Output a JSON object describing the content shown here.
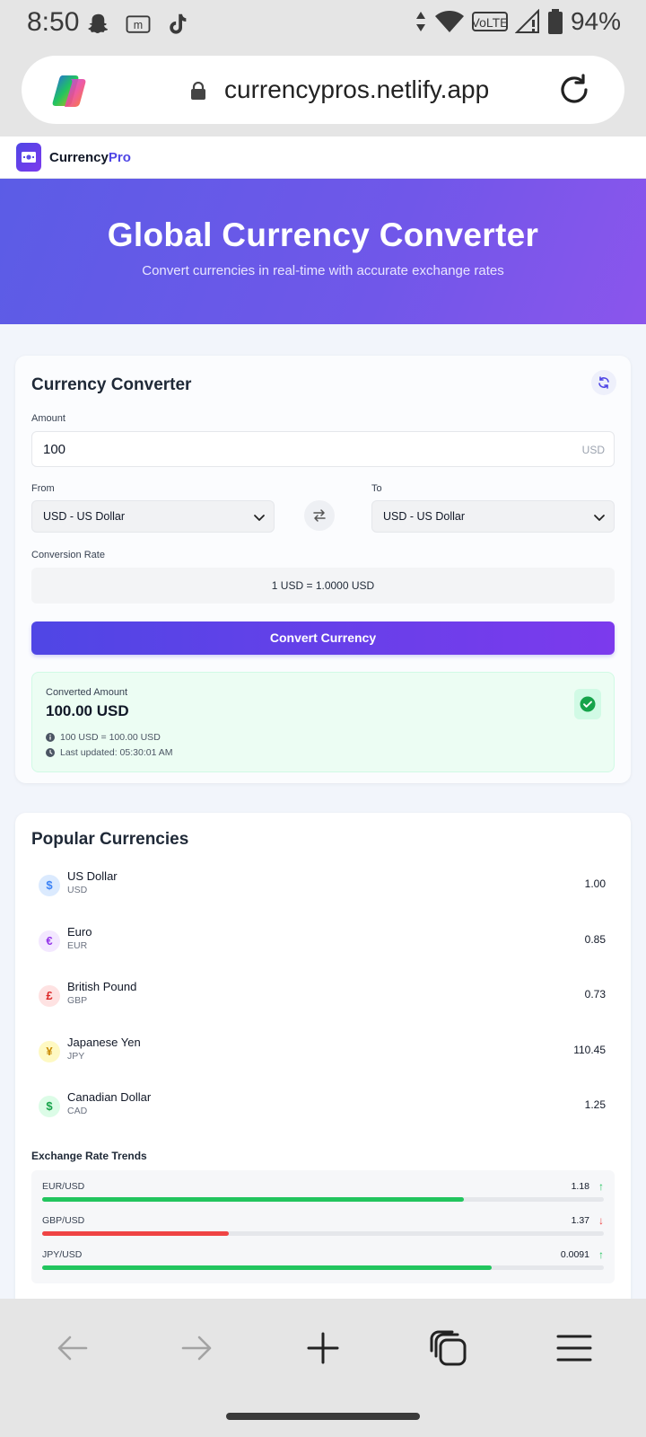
{
  "status_bar": {
    "time": "8:50",
    "battery": "94%"
  },
  "browser": {
    "url": "currencypros.netlify.app"
  },
  "site": {
    "brand_main": "Currency",
    "brand_accent": "Pro"
  },
  "hero": {
    "title": "Global Currency Converter",
    "subtitle": "Convert currencies in real-time with accurate exchange rates"
  },
  "converter": {
    "title": "Currency Converter",
    "amount_label": "Amount",
    "amount_value": "100",
    "amount_suffix": "USD",
    "from_label": "From",
    "from_value": "USD - US Dollar",
    "to_label": "To",
    "to_value": "USD - US Dollar",
    "rate_label": "Conversion Rate",
    "rate_value": "1 USD = 1.0000 USD",
    "convert_button": "Convert Currency",
    "result_label": "Converted Amount",
    "result_value": "100.00 USD",
    "result_detail": "100 USD = 100.00 USD",
    "last_updated": "Last updated: 05:30:01 AM"
  },
  "popular": {
    "title": "Popular Currencies",
    "items": [
      {
        "symbol": "$",
        "name": "US Dollar",
        "code": "USD",
        "rate": "1.00",
        "color": "#3b82f6",
        "bg": "#dbeafe"
      },
      {
        "symbol": "€",
        "name": "Euro",
        "code": "EUR",
        "rate": "0.85",
        "color": "#9333ea",
        "bg": "#f3e8ff"
      },
      {
        "symbol": "£",
        "name": "British Pound",
        "code": "GBP",
        "rate": "0.73",
        "color": "#dc2626",
        "bg": "#fee2e2"
      },
      {
        "symbol": "¥",
        "name": "Japanese Yen",
        "code": "JPY",
        "rate": "110.45",
        "color": "#ca8a04",
        "bg": "#fef9c3"
      },
      {
        "symbol": "$",
        "name": "Canadian Dollar",
        "code": "CAD",
        "rate": "1.25",
        "color": "#16a34a",
        "bg": "#dcfce7"
      }
    ]
  },
  "trends": {
    "title": "Exchange Rate Trends",
    "items": [
      {
        "pair": "EUR/USD",
        "value": "1.18",
        "arrow": "↑",
        "direction": "up",
        "color": "#22c55e",
        "fill_fraction": 0.75
      },
      {
        "pair": "GBP/USD",
        "value": "1.37",
        "arrow": "↓",
        "direction": "down",
        "color": "#ef4444",
        "fill_fraction": 0.333
      },
      {
        "pair": "JPY/USD",
        "value": "0.0091",
        "arrow": "↑",
        "direction": "up",
        "color": "#22c55e",
        "fill_fraction": 0.8
      }
    ]
  }
}
